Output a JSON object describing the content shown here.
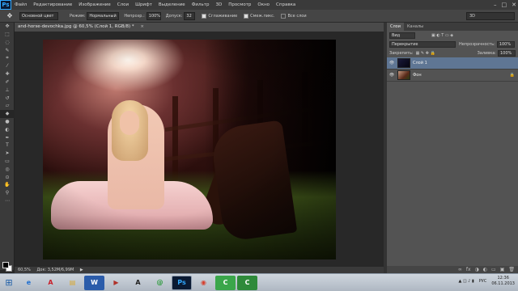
{
  "menubar": {
    "logo": "Ps",
    "items": [
      "Файл",
      "Редактирование",
      "Изображение",
      "Слои",
      "Шрифт",
      "Выделение",
      "Фильтр",
      "3D",
      "Просмотр",
      "Окно",
      "Справка"
    ],
    "win_controls": [
      "–",
      "□",
      "✕"
    ]
  },
  "options": {
    "tool_glyph": "✥",
    "preset": "Основной цвет",
    "mode_label": "Режим:",
    "mode_value": "Нормальный",
    "opacity_label": "Непрозр.:",
    "opacity_value": "100%",
    "tolerance_label": "Допуск:",
    "tolerance_value": "32",
    "antialias_label": "Сглаживание",
    "contiguous_label": "Смеж.пикс.",
    "all_layers_label": "Все слои",
    "workspace": "3D"
  },
  "document": {
    "tab_title": "and-horse-devochka.jpg @ 60,5% (Слой 1, RGB/8) *",
    "close": "×"
  },
  "status": {
    "zoom": "60,5%",
    "doc_info": "Док: 3,52M/6,99M",
    "arrow": "▶"
  },
  "panels": {
    "tabs": [
      "Слои",
      "Каналы"
    ],
    "kind_label": "Вид",
    "blend_mode": "Перекрытие",
    "opacity_label": "Непрозрачность:",
    "opacity_value": "100%",
    "lock_label": "Закрепить:",
    "fill_label": "Заливка:",
    "fill_value": "100%",
    "layers": [
      {
        "name": "Слой 1",
        "selected": true,
        "locked": false
      },
      {
        "name": "Фон",
        "selected": false,
        "locked": true
      }
    ],
    "footer_icons": [
      "∞",
      "fx",
      "◑",
      "◐",
      "▭",
      "▣",
      "🗑"
    ]
  },
  "taskbar": {
    "start_glyph": "⊞",
    "apps": [
      {
        "name": "ie",
        "glyph": "e",
        "color": "#1f6fd0"
      },
      {
        "name": "acrobat",
        "glyph": "A",
        "color": "#c8202b"
      },
      {
        "name": "explorer",
        "glyph": "▤",
        "color": "#d9a933"
      },
      {
        "name": "word",
        "glyph": "W",
        "color": "#2b5caa"
      },
      {
        "name": "media",
        "glyph": "▶",
        "color": "#b0322a"
      },
      {
        "name": "aimp",
        "glyph": "A",
        "color": "#222222"
      },
      {
        "name": "app7",
        "glyph": "@",
        "color": "#2a9a3a"
      },
      {
        "name": "photoshop",
        "glyph": "Ps",
        "color": "#0a1a33"
      },
      {
        "name": "chrome",
        "glyph": "◉",
        "color": "#d6402f"
      },
      {
        "name": "camtasia",
        "glyph": "C",
        "color": "#3aa64a"
      },
      {
        "name": "camrec",
        "glyph": "C",
        "color": "#2e8a3a"
      }
    ],
    "lang": "РУС",
    "time": "12:36",
    "date": "06.11.2013"
  },
  "colors": {
    "accent": "#31a8ff",
    "selected_layer": "#5f7694"
  }
}
